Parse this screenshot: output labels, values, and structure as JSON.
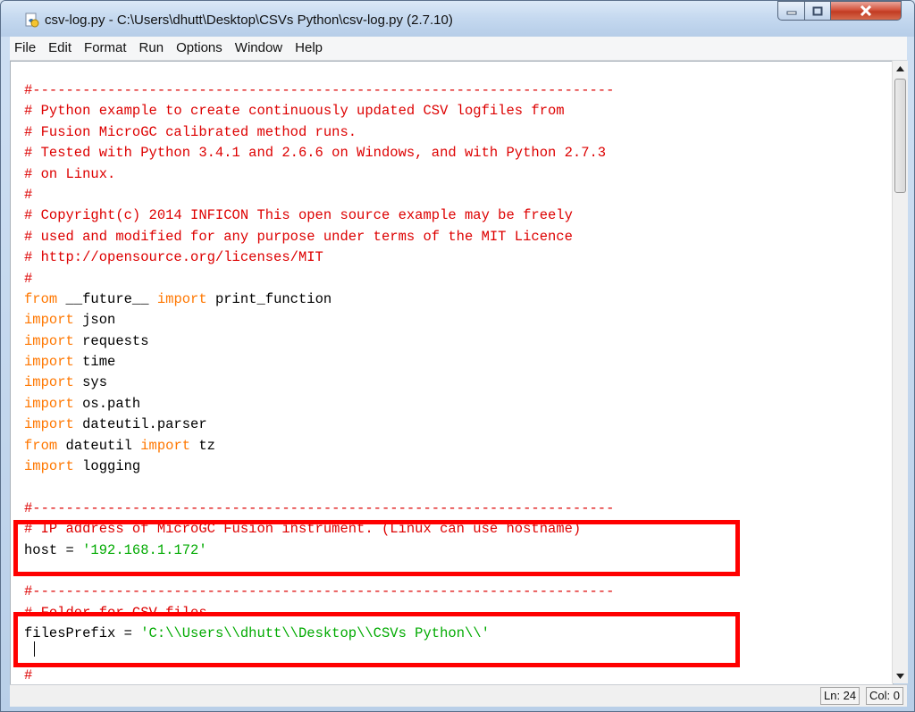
{
  "window": {
    "title": "csv-log.py - C:\\Users\\dhutt\\Desktop\\CSVs Python\\csv-log.py (2.7.10)",
    "icon": "python-file-icon"
  },
  "menu": [
    "File",
    "Edit",
    "Format",
    "Run",
    "Options",
    "Window",
    "Help"
  ],
  "code_lines": [
    [
      {
        "t": "#----------------------------------------------------------------------",
        "c": "comment"
      }
    ],
    [
      {
        "t": "# Python example to create continuously updated CSV logfiles from",
        "c": "comment"
      }
    ],
    [
      {
        "t": "# Fusion MicroGC calibrated method runs.",
        "c": "comment"
      }
    ],
    [
      {
        "t": "# Tested with Python 3.4.1 and 2.6.6 on Windows, and with Python 2.7.3",
        "c": "comment"
      }
    ],
    [
      {
        "t": "# on Linux.",
        "c": "comment"
      }
    ],
    [
      {
        "t": "#",
        "c": "comment"
      }
    ],
    [
      {
        "t": "# Copyright(c) 2014 INFICON This open source example may be freely",
        "c": "comment"
      }
    ],
    [
      {
        "t": "# used and modified for any purpose under terms of the MIT Licence",
        "c": "comment"
      }
    ],
    [
      {
        "t": "# http://opensource.org/licenses/MIT",
        "c": "comment"
      }
    ],
    [
      {
        "t": "#",
        "c": "comment"
      }
    ],
    [
      {
        "t": "from",
        "c": "kw"
      },
      {
        "t": " __future__ ",
        "c": ""
      },
      {
        "t": "import",
        "c": "kw"
      },
      {
        "t": " print_function",
        "c": ""
      }
    ],
    [
      {
        "t": "import",
        "c": "kw"
      },
      {
        "t": " json",
        "c": ""
      }
    ],
    [
      {
        "t": "import",
        "c": "kw"
      },
      {
        "t": " requests",
        "c": ""
      }
    ],
    [
      {
        "t": "import",
        "c": "kw"
      },
      {
        "t": " time",
        "c": ""
      }
    ],
    [
      {
        "t": "import",
        "c": "kw"
      },
      {
        "t": " sys",
        "c": ""
      }
    ],
    [
      {
        "t": "import",
        "c": "kw"
      },
      {
        "t": " os.path",
        "c": ""
      }
    ],
    [
      {
        "t": "import",
        "c": "kw"
      },
      {
        "t": " dateutil.parser",
        "c": ""
      }
    ],
    [
      {
        "t": "from",
        "c": "kw"
      },
      {
        "t": " dateutil ",
        "c": ""
      },
      {
        "t": "import",
        "c": "kw"
      },
      {
        "t": " tz",
        "c": ""
      }
    ],
    [
      {
        "t": "import",
        "c": "kw"
      },
      {
        "t": " logging",
        "c": ""
      }
    ],
    [
      {
        "t": "",
        "c": ""
      }
    ],
    [
      {
        "t": "#----------------------------------------------------------------------",
        "c": "comment"
      }
    ],
    [
      {
        "t": "# IP address of MicroGC Fusion instrument. (Linux can use hostname)",
        "c": "comment"
      }
    ],
    [
      {
        "t": "host = ",
        "c": ""
      },
      {
        "t": "'192.168.1.172'",
        "c": "str"
      }
    ],
    [
      {
        "t": "",
        "c": ""
      }
    ],
    [
      {
        "t": "#----------------------------------------------------------------------",
        "c": "comment"
      }
    ],
    [
      {
        "t": "# Folder for CSV files",
        "c": "comment"
      }
    ],
    [
      {
        "t": "filesPrefix = ",
        "c": ""
      },
      {
        "t": "'C:\\\\Users\\\\dhutt\\\\Desktop\\\\CSVs Python\\\\'",
        "c": "str"
      }
    ],
    [
      {
        "t": "",
        "c": ""
      }
    ],
    [
      {
        "t": "#",
        "c": "comment"
      }
    ]
  ],
  "status": {
    "line": "Ln: 24",
    "col": "Col: 0"
  },
  "colors": {
    "comment": "#dd0000",
    "keyword": "#ff7700",
    "string": "#00aa00",
    "highlight_box": "#ff0000"
  }
}
